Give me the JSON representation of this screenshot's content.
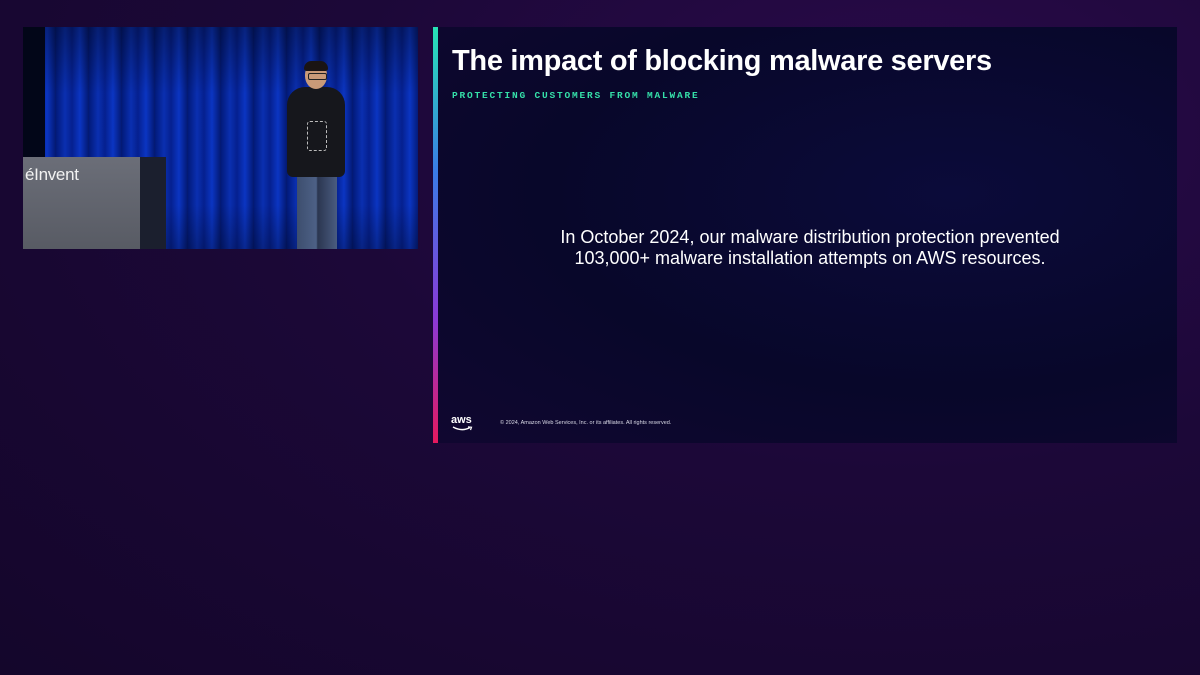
{
  "video_feed": {
    "lectern_text": "éInvent"
  },
  "slide": {
    "title": "The impact of blocking malware servers",
    "subtitle": "PROTECTING CUSTOMERS FROM MALWARE",
    "body_lines": [
      "In October 2024, our malware distribution protection prevented",
      "103,000+ malware installation attempts on AWS resources."
    ],
    "logo_text": "aws",
    "copyright": "© 2024, Amazon Web Services, Inc. or its affiliates. All rights reserved.",
    "colors": {
      "subtitle_accent": "#35e0a9",
      "accent_bar_top": "#27e3b5",
      "accent_bar_bottom": "#e6195e"
    }
  }
}
